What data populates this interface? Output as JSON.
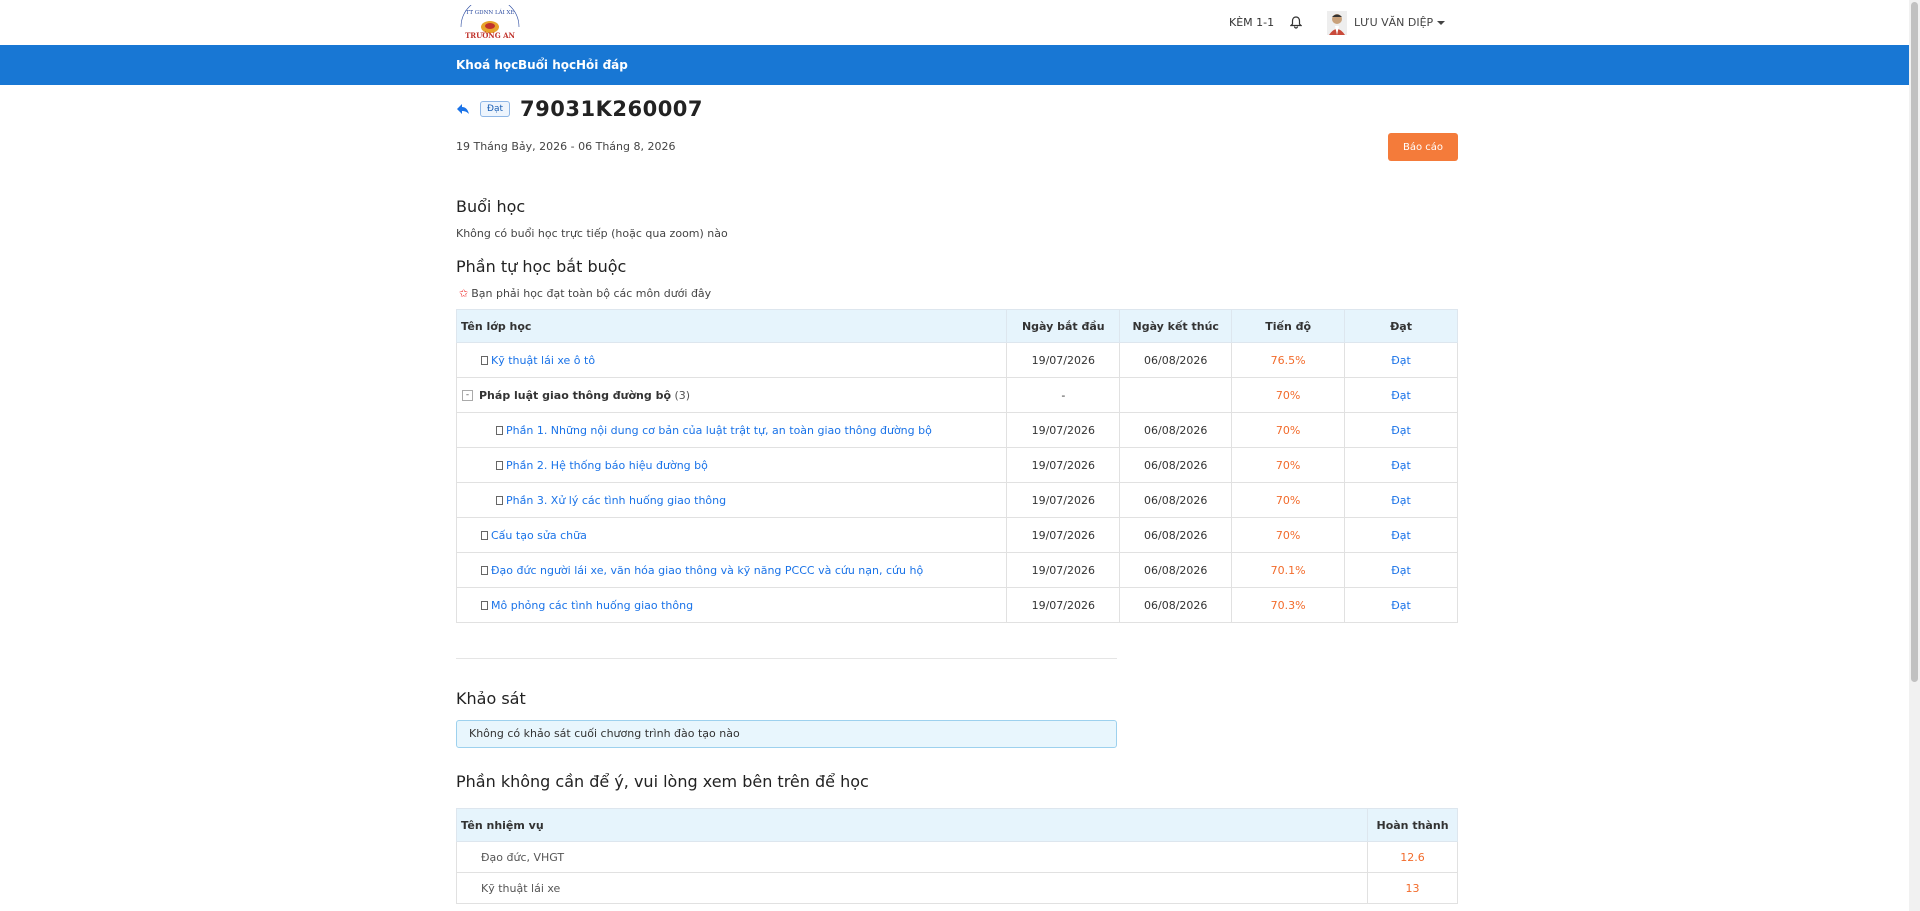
{
  "header": {
    "logo_alt": "TRƯỜNG AN",
    "logo_text": "TRƯỜNG AN",
    "kem_label": "KÈM 1-1",
    "user_name": "LƯU VĂN DIỆP"
  },
  "nav": {
    "items": [
      "Khoá học",
      "Buổi học",
      "Hỏi đáp"
    ]
  },
  "course": {
    "status_badge": "Đạt",
    "code": "79031K260007",
    "date_range": "19 Tháng Bảy, 2026 - 06 Tháng 8, 2026",
    "report_button": "Báo cáo"
  },
  "sessions": {
    "title": "Buổi học",
    "empty_text": "Không có buổi học trực tiếp (hoặc qua zoom) nào"
  },
  "mandatory": {
    "title": "Phần tự học bắt buộc",
    "note": "Bạn phải học đạt toàn bộ các môn dưới đây",
    "columns": [
      "Tên lớp học",
      "Ngày bắt đầu",
      "Ngày kết thúc",
      "Tiến độ",
      "Đạt"
    ],
    "rows": [
      {
        "name": "Kỹ thuật lái xe ô tô",
        "start": "19/07/2026",
        "end": "06/08/2026",
        "progress": "76.5%",
        "pass": "Đạt"
      },
      {
        "name": "Pháp luật giao thông đường bộ",
        "count": "(3)",
        "start": "-",
        "end": "",
        "progress": "70%",
        "pass": "Đạt"
      },
      {
        "name": "Phần 1. Những nội dung cơ bản của luật trật tự, an toàn giao thông đường bộ",
        "start": "19/07/2026",
        "end": "06/08/2026",
        "progress": "70%",
        "pass": "Đạt"
      },
      {
        "name": "Phần 2. Hệ thống báo hiệu đường bộ",
        "start": "19/07/2026",
        "end": "06/08/2026",
        "progress": "70%",
        "pass": "Đạt"
      },
      {
        "name": "Phần 3. Xử lý các tình huống giao thông",
        "start": "19/07/2026",
        "end": "06/08/2026",
        "progress": "70%",
        "pass": "Đạt"
      },
      {
        "name": "Cấu tạo sửa chữa",
        "start": "19/07/2026",
        "end": "06/08/2026",
        "progress": "70%",
        "pass": "Đạt"
      },
      {
        "name": "Đạo đức người lái xe, văn hóa giao thông và kỹ năng PCCC và cứu nạn, cứu hộ",
        "start": "19/07/2026",
        "end": "06/08/2026",
        "progress": "70.1%",
        "pass": "Đạt"
      },
      {
        "name": "Mô phỏng các tình huống giao thông",
        "start": "19/07/2026",
        "end": "06/08/2026",
        "progress": "70.3%",
        "pass": "Đạt"
      }
    ]
  },
  "survey": {
    "title": "Khảo sát",
    "empty_text": "Không có khảo sát cuối chương trình đào tạo nào"
  },
  "optional": {
    "title": "Phần không cần để ý, vui lòng xem bên trên để học",
    "columns": [
      "Tên nhiệm vụ",
      "Hoàn thành"
    ],
    "rows": [
      {
        "name": "Đạo đức, VHGT",
        "done": "12.6"
      },
      {
        "name": "Kỹ thuật lái xe",
        "done": "13"
      }
    ]
  },
  "colors": {
    "nav_blue": "#1877d4",
    "accent_orange": "#f47b3a",
    "link_blue": "#1a73e8",
    "table_header": "#e6f4fc"
  }
}
